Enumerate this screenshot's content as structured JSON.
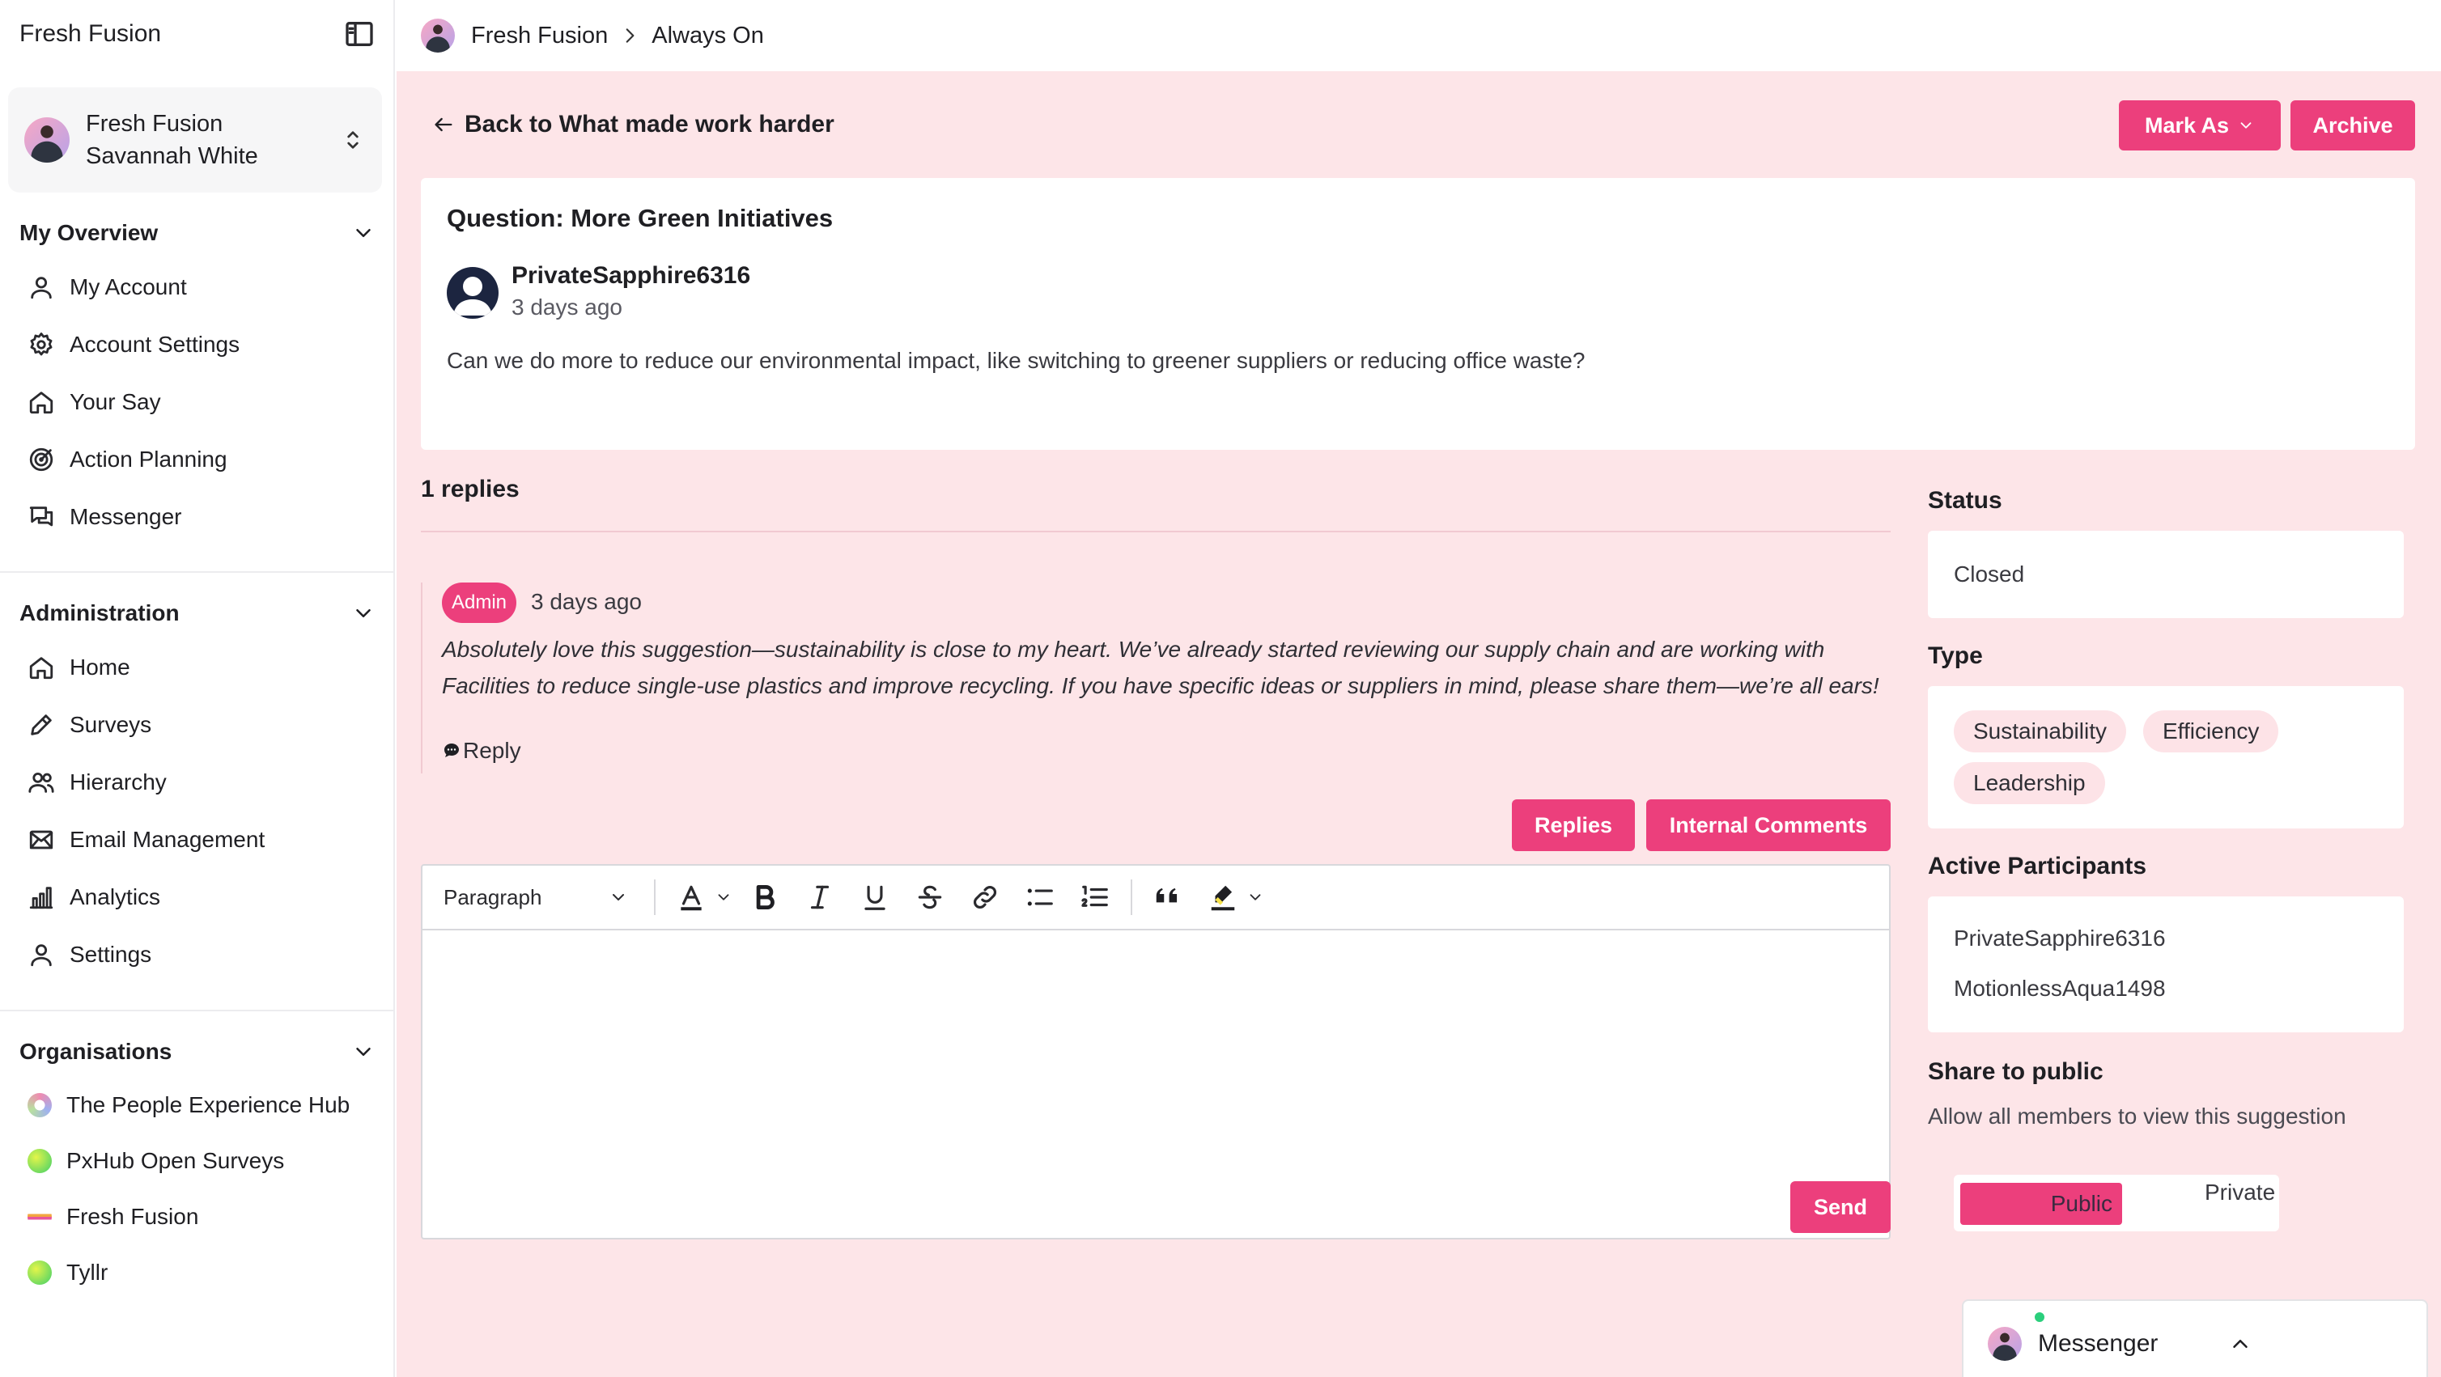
{
  "sidebar": {
    "brand": "Fresh Fusion",
    "account": {
      "org": "Fresh Fusion",
      "user": "Savannah White"
    },
    "sections": {
      "overview": {
        "title": "My Overview",
        "items": [
          "My Account",
          "Account Settings",
          "Your Say",
          "Action Planning",
          "Messenger"
        ]
      },
      "admin": {
        "title": "Administration",
        "items": [
          "Home",
          "Surveys",
          "Hierarchy",
          "Email Management",
          "Analytics",
          "Settings"
        ]
      },
      "orgs": {
        "title": "Organisations",
        "items": [
          "The People Experience Hub",
          "PxHub Open Surveys",
          "Fresh Fusion",
          "Tyllr"
        ]
      }
    }
  },
  "breadcrumb": {
    "org": "Fresh Fusion",
    "page": "Always On"
  },
  "header": {
    "back_label": "Back to What made work harder",
    "mark_as_label": "Mark As",
    "archive_label": "Archive"
  },
  "question": {
    "title": "Question: More Green Initiatives",
    "author": "PrivateSapphire6316",
    "time": "3 days ago",
    "body": "Can we do more to reduce our environmental impact, like switching to greener suppliers or reducing office waste?"
  },
  "replies": {
    "count_label": "1 replies",
    "items": [
      {
        "badge": "Admin",
        "time": "3 days ago",
        "body": "Absolutely love this suggestion—sustainability is close to my heart. We’ve already started reviewing our supply chain and are working with Facilities to reduce single-use plastics and improve recycling. If you have specific ideas or suppliers in mind, please share them—we’re all ears!",
        "reply_label": "Reply"
      }
    ],
    "tab_replies": "Replies",
    "tab_internal": "Internal Comments"
  },
  "editor": {
    "block_format": "Paragraph",
    "send_label": "Send"
  },
  "panel": {
    "status_label": "Status",
    "status_value": "Closed",
    "type_label": "Type",
    "types": [
      "Sustainability",
      "Efficiency",
      "Leadership"
    ],
    "participants_label": "Active Participants",
    "participants": [
      "PrivateSapphire6316",
      "MotionlessAqua1498"
    ],
    "share_label": "Share to public",
    "share_desc": "Allow all members to view this suggestion",
    "share_public": "Public",
    "share_private": "Private"
  },
  "messenger": {
    "label": "Messenger"
  },
  "colors": {
    "accent": "#ec3f7c",
    "page_bg": "#fde5e8",
    "tag_bg": "#fde3e7"
  }
}
